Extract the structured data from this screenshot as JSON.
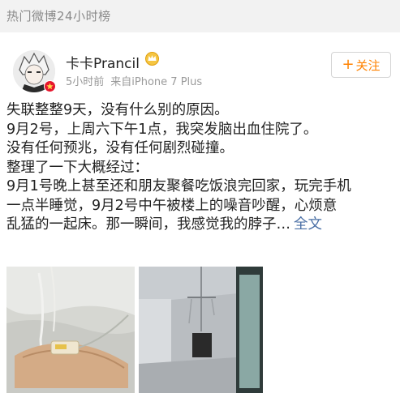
{
  "header": {
    "title": "热门微博24小时榜"
  },
  "user": {
    "name": "卡卡Prancil",
    "time": "5小时前",
    "source": "来自iPhone 7 Plus",
    "follow_label": "关注",
    "follow_plus": "+"
  },
  "post": {
    "lines": [
      "失联整整9天，没有什么别的原因。",
      "9月2号，上周六下午1点，我突发脑出血住院了。",
      "没有任何预兆，没有任何剧烈碰撞。",
      "整理了一下大概经过：",
      "9月1号晚上甚至还和朋友聚餐吃饭浪完回家，玩完手机",
      "一点半睡觉，9月2号中午被楼上的噪音吵醒，心烦意",
      "乱猛的一起床。那一瞬间，我感觉我的脖子…"
    ],
    "full_text_label": "全文"
  },
  "icons": {
    "avatar": "anime-avatar",
    "avatar_badge": "verified-badge-icon",
    "vip": "vip-crown-icon"
  },
  "colors": {
    "accent": "#ff8200",
    "link": "#4a6fa5",
    "badge": "#e6162d",
    "header_bg": "#f2f2f2"
  }
}
